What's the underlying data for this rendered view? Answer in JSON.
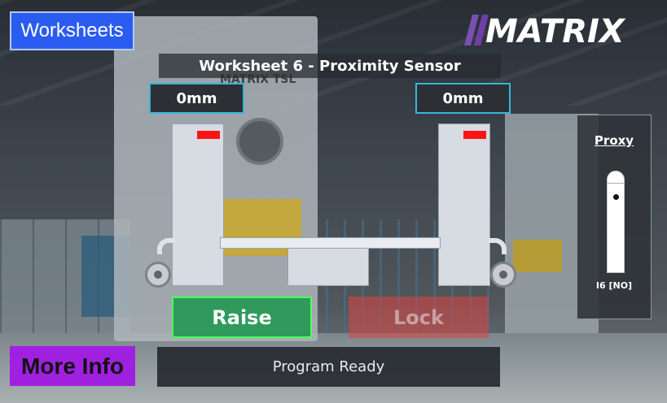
{
  "header": {
    "worksheets_label": "Worksheets",
    "logo_text": "MATRIX",
    "title": "Worksheet 6 - Proximity Sensor"
  },
  "scene": {
    "left_distance": "0mm",
    "right_distance": "0mm",
    "indicator_color": "#ff1414"
  },
  "controls": {
    "raise_label": "Raise",
    "lock_label": "Lock",
    "status": "Program Ready",
    "more_info_label": "More Info"
  },
  "proxy": {
    "title": "Proxy",
    "label": "I6 [NO]"
  },
  "colors": {
    "worksheets_bg": "#2b5cf0",
    "raise_bg": "#2f9a5c",
    "raise_border": "#4cff5a",
    "more_info_bg": "#a020e0",
    "distance_border": "#35b7d8"
  },
  "background_text": {
    "press_plate": "MATRIX TSL"
  }
}
